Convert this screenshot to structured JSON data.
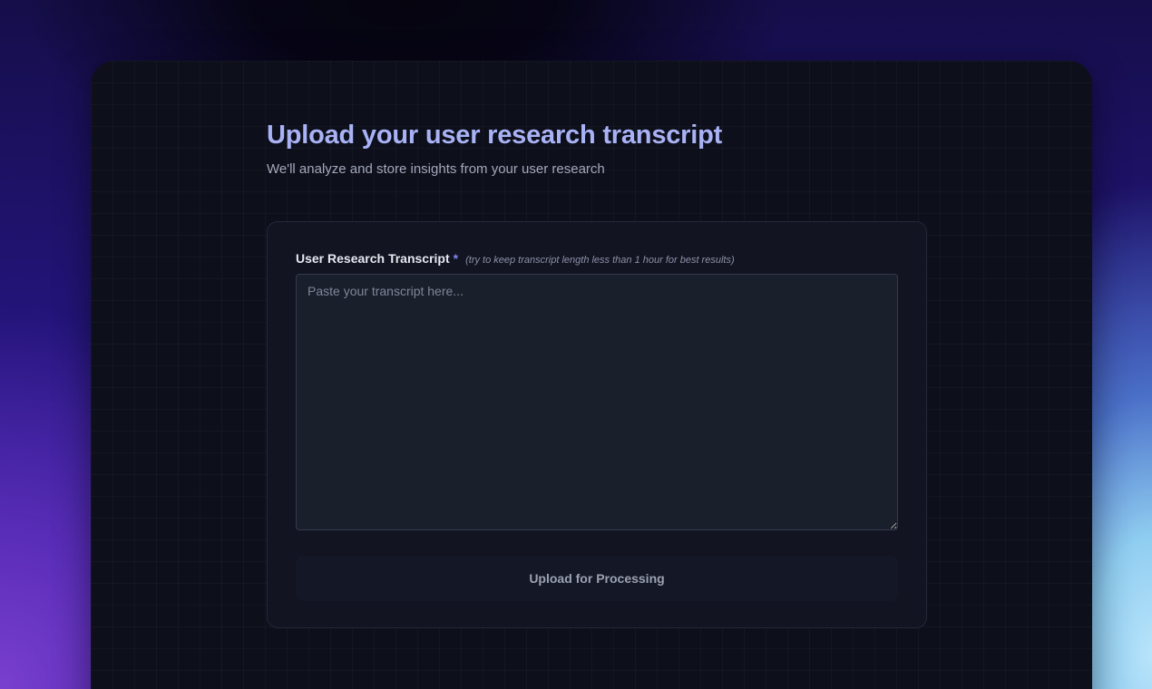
{
  "header": {
    "title": "Upload your user research transcript",
    "subtitle": "We'll analyze and store insights from your user research"
  },
  "form": {
    "label": "User Research Transcript",
    "required_mark": "*",
    "hint": "(try to keep transcript length less than 1 hour for best results)",
    "transcript_value": "",
    "transcript_placeholder": "Paste your transcript here...",
    "submit_label": "Upload for Processing"
  },
  "colors": {
    "title": "#a9b2f5",
    "accent": "#7f84ee",
    "window_bg": "#0d0f1b",
    "card_bg": "#121522",
    "input_bg": "#1a1f2c",
    "button_bg": "#141826"
  }
}
